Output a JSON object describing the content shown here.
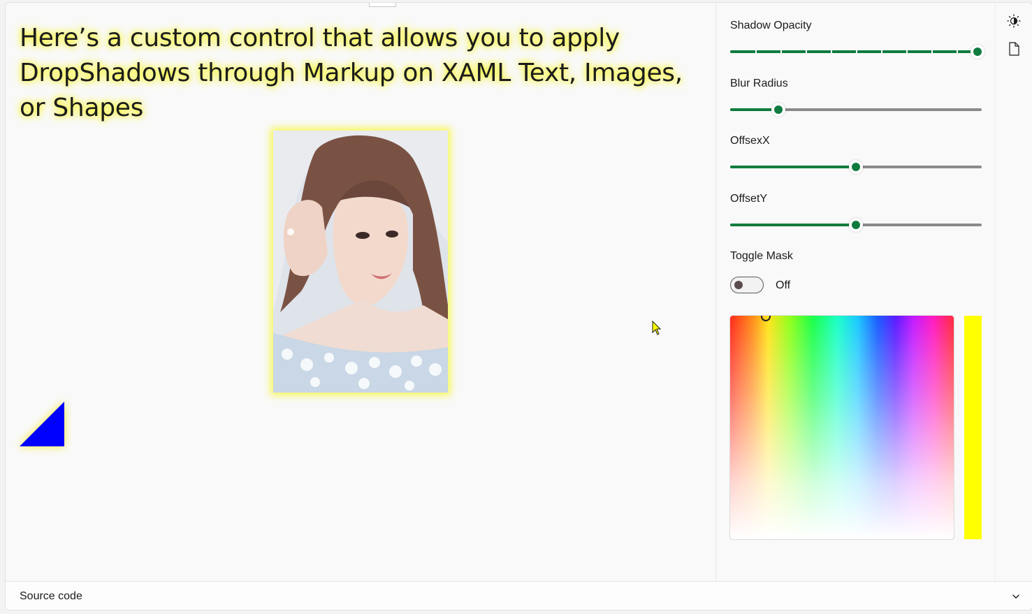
{
  "demo": {
    "headline": "Here’s a custom control that allows you to apply DropShadows through Markup on XAML Text, Images, or Shapes",
    "shadow_color": "#ffff00",
    "triangle_color": "#0000ff"
  },
  "options": {
    "shadow_opacity": {
      "label": "Shadow Opacity",
      "value": 1.0
    },
    "blur_radius": {
      "label": "Blur Radius",
      "value": 0.18
    },
    "offset_x": {
      "label": "OffsexX",
      "value": 0.5
    },
    "offset_y": {
      "label": "OffsetY",
      "value": 0.5
    },
    "toggle_mask": {
      "label": "Toggle Mask",
      "state": "Off"
    },
    "selected_color": "#ffff00"
  },
  "rail": {
    "icons": [
      "theme-toggle-icon",
      "document-icon"
    ]
  },
  "footer": {
    "source_label": "Source code"
  }
}
